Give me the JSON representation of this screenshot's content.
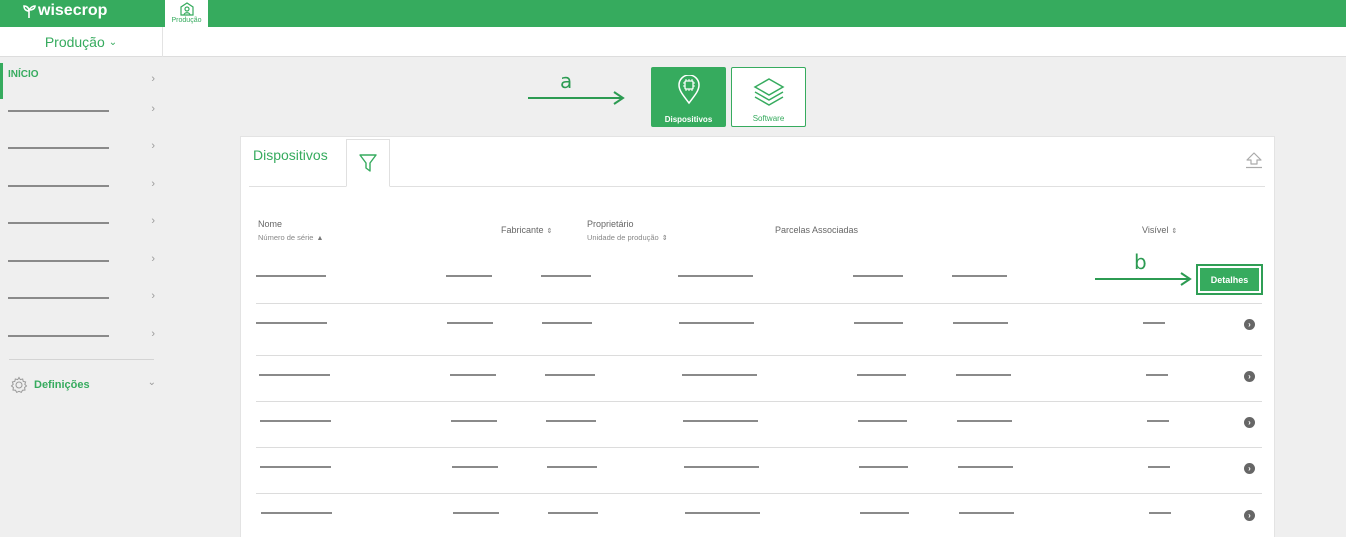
{
  "app": {
    "logo_text": "wisecrop",
    "production_tab_label": "Produção",
    "production_select": "Produção"
  },
  "sidebar": {
    "start_label": "INÍCIO",
    "settings_label": "Definições"
  },
  "annotations": {
    "a": "a",
    "b": "b"
  },
  "view_toggle": {
    "devices_label": "Dispositivos",
    "software_label": "Software"
  },
  "card": {
    "title": "Dispositivos"
  },
  "table": {
    "headers": {
      "name": "Nome",
      "serial": "Número de série",
      "manufacturer": "Fabricante",
      "owner": "Proprietário",
      "production_unit": "Unidade de produção",
      "parcels": "Parcelas Associadas",
      "visible": "Visível"
    },
    "details_button": "Detalhes"
  },
  "colors": {
    "brand": "#36ab5e",
    "background": "#efefef"
  }
}
